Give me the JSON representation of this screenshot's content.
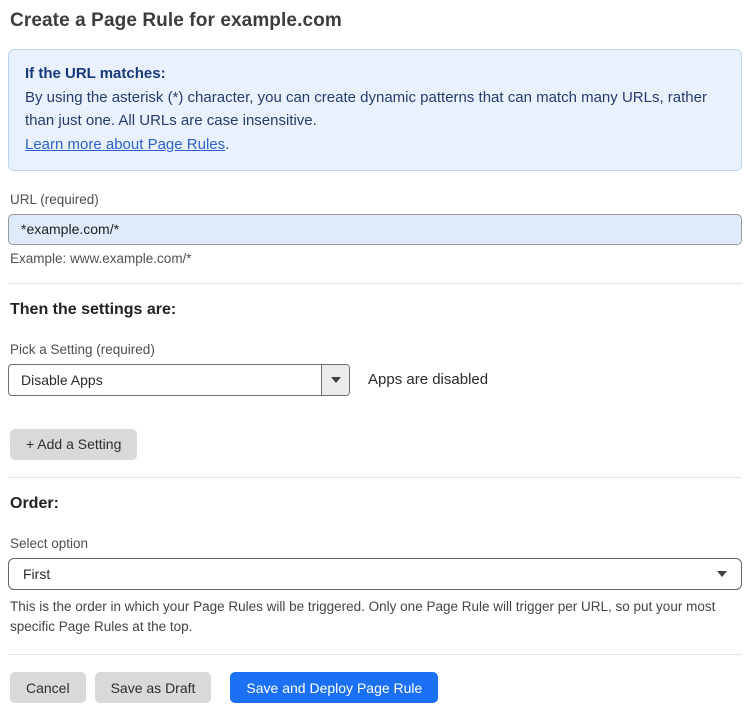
{
  "page": {
    "title": "Create a Page Rule for example.com"
  },
  "info_box": {
    "heading": "If the URL matches:",
    "body": "By using the asterisk (*) character, you can create dynamic patterns that can match many URLs, rather than just one. All URLs are case insensitive.",
    "link_text": "Learn more about Page Rules",
    "link_suffix": "."
  },
  "url_field": {
    "label": "URL (required)",
    "value": "*example.com/*",
    "helper": "Example: www.example.com/*"
  },
  "settings_section": {
    "heading": "Then the settings are:",
    "picker_label": "Pick a Setting (required)",
    "picker_value": "Disable Apps",
    "picker_caret_icon": "caret-down",
    "status_text": "Apps are disabled",
    "add_button_label": "+ Add a Setting"
  },
  "order_section": {
    "heading": "Order:",
    "select_label": "Select option",
    "select_value": "First",
    "select_caret_icon": "caret-down",
    "helper": "This is the order in which your Page Rules will be triggered. Only one Page Rule will trigger per URL, so put your most specific Page Rules at the top."
  },
  "footer": {
    "cancel_label": "Cancel",
    "save_draft_label": "Save as Draft",
    "save_deploy_label": "Save and Deploy Page Rule"
  },
  "colors": {
    "info_box_bg": "#e9f2fc",
    "info_box_border": "#bcd6f1",
    "info_heading_text": "#16387c",
    "info_body_text": "#253d6d",
    "link_blue": "#2f62c9",
    "input_bg": "#dfeafa",
    "primary_button_blue": "#1b70f4",
    "gray_button_bg": "#d9d9d9"
  }
}
